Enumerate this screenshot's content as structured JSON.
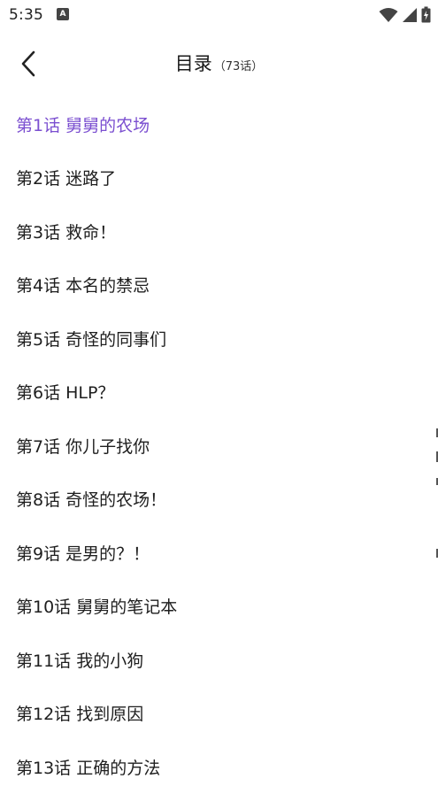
{
  "status_bar": {
    "time": "5:35",
    "notification_glyph": "A"
  },
  "header": {
    "title": "目录",
    "count": "（73话）"
  },
  "chapters": [
    {
      "label": "第1话",
      "name": "舅舅的农场",
      "active": true
    },
    {
      "label": "第2话",
      "name": "迷路了"
    },
    {
      "label": "第3话",
      "name": "救命！"
    },
    {
      "label": "第4话",
      "name": "本名的禁忌"
    },
    {
      "label": "第5话",
      "name": "奇怪的同事们"
    },
    {
      "label": "第6话",
      "name": "HLP？"
    },
    {
      "label": "第7话",
      "name": "你儿子找你"
    },
    {
      "label": "第8话",
      "name": "奇怪的农场！"
    },
    {
      "label": "第9话",
      "name": "是男的？！"
    },
    {
      "label": "第10话",
      "name": "舅舅的笔记本"
    },
    {
      "label": "第11话",
      "name": "我的小狗"
    },
    {
      "label": "第12话",
      "name": "找到原因"
    },
    {
      "label": "第13话",
      "name": "正确的方法"
    }
  ],
  "colors": {
    "active_chapter": "#7b4fd0",
    "text": "#1e1e1e",
    "background": "#ffffff"
  },
  "icons": {
    "back": "chevron-left-icon",
    "wifi": "wifi-icon",
    "signal": "cell-signal-icon",
    "battery": "battery-icon"
  }
}
